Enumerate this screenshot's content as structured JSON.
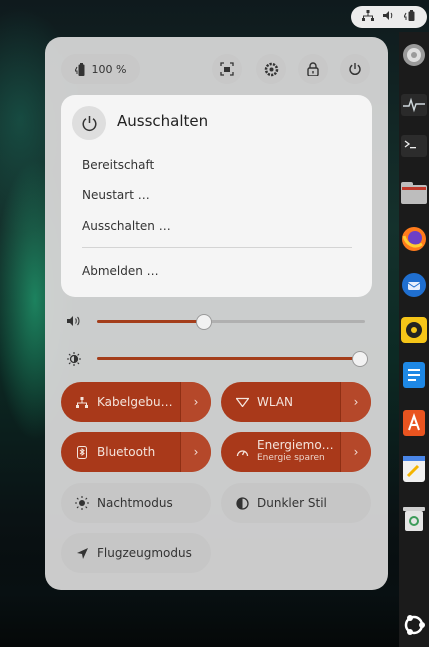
{
  "colors": {
    "accent": "#a9391a",
    "panel": "#d6d6d6",
    "menu": "#f5f5f5"
  },
  "tray": {
    "icons": [
      "network-wired-icon",
      "volume-icon",
      "battery-icon"
    ]
  },
  "header": {
    "battery": {
      "icon": "battery-icon",
      "label": "100 %"
    },
    "buttons": [
      "screenshot-icon",
      "settings-icon",
      "lock-icon",
      "power-icon"
    ]
  },
  "power_menu": {
    "title": "Ausschalten",
    "items": [
      "Bereitschaft",
      "Neustart …",
      "Ausschalten …"
    ],
    "logout": "Abmelden …"
  },
  "sliders": {
    "volume_level": 0.4,
    "brightness_level": 0.98
  },
  "toggles": {
    "wired": {
      "label": "Kabelgebu…",
      "active": true
    },
    "wlan": {
      "label": "WLAN",
      "active": true
    },
    "bluetooth": {
      "label": "Bluetooth",
      "active": true
    },
    "power_mode": {
      "label": "Energiemo…",
      "sub": "Energie sparen",
      "active": true
    },
    "night_light": {
      "label": "Nachtmodus",
      "active": false
    },
    "dark_style": {
      "label": "Dunkler Stil",
      "active": false
    },
    "airplane": {
      "label": "Flugzeugmodus",
      "active": false
    }
  },
  "dock": {
    "icons": [
      "settings-app-icon",
      "system-monitor-icon",
      "terminal-icon",
      "files-icon",
      "firefox-icon",
      "thunderbird-icon",
      "rhythmbox-icon",
      "writer-icon",
      "app-center-icon",
      "text-editor-icon",
      "trash-icon",
      "ubuntu-logo-icon"
    ]
  }
}
